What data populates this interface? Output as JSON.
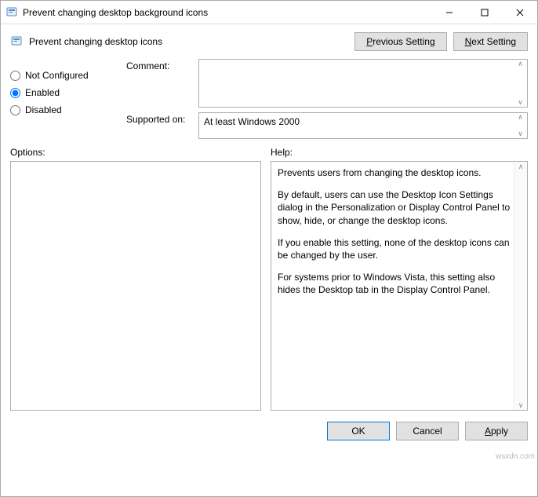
{
  "window": {
    "title": "Prevent changing desktop background icons"
  },
  "header": {
    "policy_title": "Prevent changing desktop icons",
    "prev_label": "Previous Setting",
    "next_label": "Next Setting"
  },
  "radios": {
    "not_configured": "Not Configured",
    "enabled": "Enabled",
    "disabled": "Disabled",
    "selected": "enabled"
  },
  "fields": {
    "comment_label": "Comment:",
    "comment_value": "",
    "supported_label": "Supported on:",
    "supported_value": "At least Windows 2000"
  },
  "columns": {
    "options_label": "Options:",
    "help_label": "Help:"
  },
  "help": {
    "p1": "Prevents users from changing the desktop icons.",
    "p2": "By default, users can use the Desktop Icon Settings dialog in the Personalization or Display Control Panel to show, hide, or change the desktop icons.",
    "p3": "If you enable this setting, none of the desktop icons can be changed by the user.",
    "p4": "For systems prior to Windows Vista, this setting also hides the Desktop tab in the Display Control Panel."
  },
  "footer": {
    "ok": "OK",
    "cancel": "Cancel",
    "apply": "Apply"
  },
  "watermark": "wsxdn.com"
}
